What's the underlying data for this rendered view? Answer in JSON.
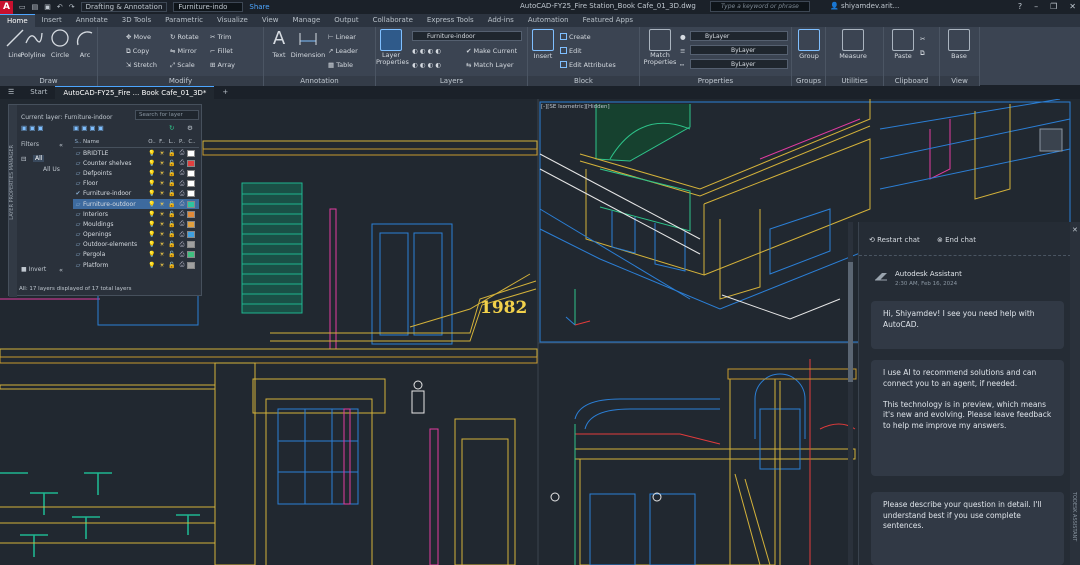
{
  "titlebar": {
    "workspace": "Drafting & Annotation",
    "layer": "Furniture-indo",
    "share": "Share",
    "title": "AutoCAD-FY25_Fire Station_Book Cafe_01_3D.dwg",
    "search_placeholder": "Type a keyword or phrase",
    "user": "shiyamdev.arit..."
  },
  "ribbon_tabs": [
    "Home",
    "Insert",
    "Annotate",
    "3D Tools",
    "Parametric",
    "Visualize",
    "View",
    "Manage",
    "Output",
    "Collaborate",
    "Express Tools",
    "Add-ins",
    "Automation",
    "Featured Apps"
  ],
  "ribbon": {
    "draw": {
      "label": "Draw",
      "tools": [
        "Line",
        "Polyline",
        "Circle",
        "Arc"
      ]
    },
    "modify": {
      "label": "Modify",
      "tools": [
        "Move",
        "Rotate",
        "Trim",
        "Copy",
        "Mirror",
        "Fillet",
        "Stretch",
        "Scale",
        "Array"
      ]
    },
    "annotation": {
      "label": "Annotation",
      "tools": [
        "Text",
        "Dimension",
        "Linear",
        "Leader",
        "Table"
      ]
    },
    "layers": {
      "label": "Layers",
      "big": "Layer Properties",
      "current": "Furniture-indoor",
      "make_current": "Make Current",
      "match_layer": "Match Layer"
    },
    "block": {
      "label": "Block",
      "tools": [
        "Insert",
        "Create",
        "Edit",
        "Edit Attributes"
      ]
    },
    "properties": {
      "label": "Properties",
      "big": "Match Properties",
      "bylayer": "ByLayer"
    },
    "groups": {
      "label": "Groups",
      "big": "Group"
    },
    "utilities": {
      "label": "Utilities",
      "big": "Measure"
    },
    "clipboard": {
      "label": "Clipboard",
      "big": "Paste"
    },
    "view": {
      "label": "View",
      "big": "Base"
    }
  },
  "file_tabs": [
    "Start",
    "AutoCAD-FY25_Fire ... Book Cafe_01_3D*"
  ],
  "layer_manager": {
    "current": "Current layer: Furniture-indoor",
    "search_placeholder": "Search for layer",
    "filters_label": "Filters",
    "tree_all": "All",
    "tree_all_used": "All Us",
    "invert_label": "Invert",
    "footer": "All: 17 layers displayed of 17 total layers",
    "columns": [
      "S..",
      "Name",
      "O..",
      "F..",
      "L..",
      "P..",
      "C.."
    ],
    "side_label": "LAYER PROPERTIES MANAGER",
    "rows": [
      {
        "name": "BRIDTLE",
        "color": "#ffffff"
      },
      {
        "name": "Counter shelves",
        "color": "#e04040"
      },
      {
        "name": "Defpoints",
        "color": "#ffffff"
      },
      {
        "name": "Floor",
        "color": "#ffffff"
      },
      {
        "name": "Furniture-indoor",
        "color": "#ffffff"
      },
      {
        "name": "Furniture-outdoor",
        "color": "#2ec4a0"
      },
      {
        "name": "Interiors",
        "color": "#e08a3a"
      },
      {
        "name": "Mouldings",
        "color": "#e0a040"
      },
      {
        "name": "Openings",
        "color": "#40a0e0"
      },
      {
        "name": "Outdoor-elements",
        "color": "#a0a0a0"
      },
      {
        "name": "Pergola",
        "color": "#40c080"
      },
      {
        "name": "Platform",
        "color": "#a0a0a0"
      }
    ],
    "selected_index": 5
  },
  "viewport_label": "[-][SE Isometric][Hidden]",
  "year_sign": "1982",
  "assistant": {
    "restart": "Restart chat",
    "end": "End chat",
    "name": "Autodesk Assistant",
    "time": "2:30 AM, Feb 16, 2024",
    "side_label": "TODESK ASSISTANT",
    "messages": [
      "Hi, Shiyamdev! I see you need help with AutoCAD.",
      "I use AI to recommend solutions and can connect you to an agent, if needed.\n\nThis technology is in preview, which means it's new and evolving. Please leave feedback to help me improve my answers.",
      "Please describe your question in detail. I'll understand best if you use complete sentences."
    ]
  }
}
